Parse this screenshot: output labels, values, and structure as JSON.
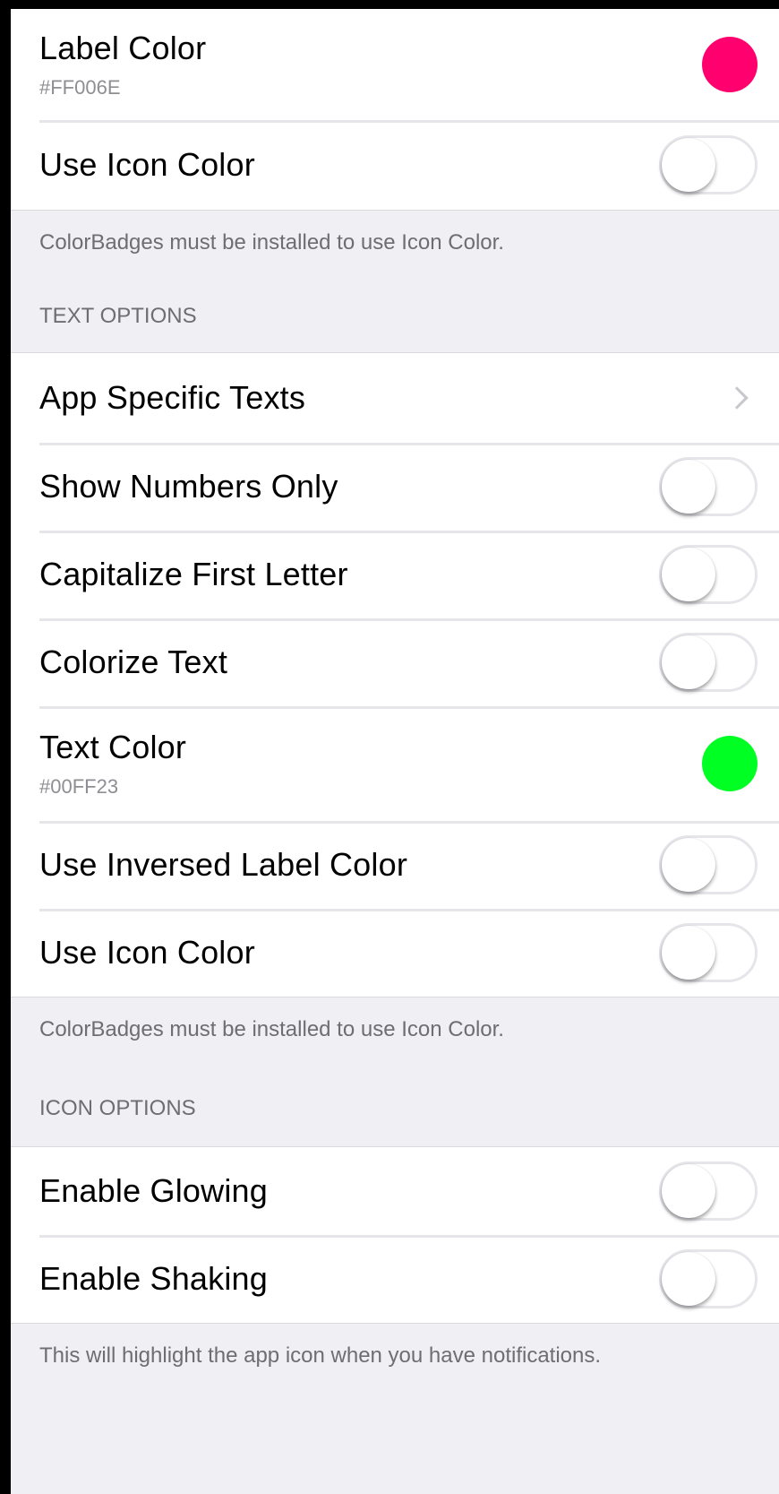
{
  "colors": {
    "label_swatch": "#FF006E",
    "text_swatch": "#00FF23"
  },
  "group1": {
    "label_color": {
      "title": "Label Color",
      "value": "#FF006E"
    },
    "use_icon_color": {
      "title": "Use Icon Color",
      "on": false
    },
    "footer": "ColorBadges must be installed to use Icon Color."
  },
  "text_options": {
    "header": "TEXT OPTIONS",
    "app_specific_texts": {
      "title": "App Specific Texts",
      "icon": "chevron-right-icon"
    },
    "show_numbers_only": {
      "title": "Show Numbers Only",
      "on": false
    },
    "capitalize_first_letter": {
      "title": "Capitalize First Letter",
      "on": false
    },
    "colorize_text": {
      "title": "Colorize Text",
      "on": false
    },
    "text_color": {
      "title": "Text Color",
      "value": "#00FF23"
    },
    "use_inversed_label_color": {
      "title": "Use Inversed Label Color",
      "on": false
    },
    "use_icon_color": {
      "title": "Use Icon Color",
      "on": false
    },
    "footer": "ColorBadges must be installed to use Icon Color."
  },
  "icon_options": {
    "header": "ICON OPTIONS",
    "enable_glowing": {
      "title": "Enable Glowing",
      "on": false
    },
    "enable_shaking": {
      "title": "Enable Shaking",
      "on": false
    },
    "footer": "This will highlight the app icon when you have notifications."
  }
}
